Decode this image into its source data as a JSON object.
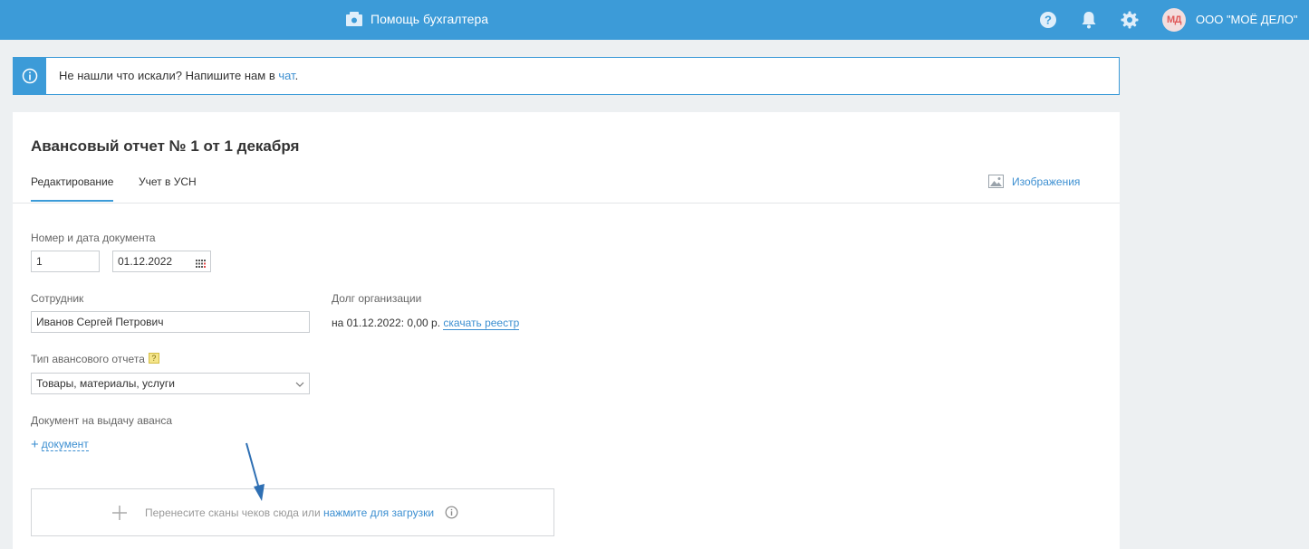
{
  "topbar": {
    "help_label": "Помощь бухгалтера",
    "org_initials": "МД",
    "org_name": "ООО \"МОЁ ДЕЛО\"",
    "bg_color": "#3c9bd8"
  },
  "banner": {
    "text": "Не нашли что искали? Напишите нам в ",
    "link": "чат",
    "suffix": "."
  },
  "document": {
    "title": "Авансовый отчет № 1 от 1 декабря",
    "tabs": [
      {
        "label": "Редактирование",
        "active": true
      },
      {
        "label": "Учет в УСН",
        "active": false
      }
    ],
    "images_label": "Изображения"
  },
  "form": {
    "number_date_label": "Номер и дата документа",
    "number_value": "1",
    "date_value": "01.12.2022",
    "employee_label": "Сотрудник",
    "employee_value": "Иванов Сергей Петрович",
    "debt_label": "Долг организации",
    "debt_text": "на 01.12.2022: 0,00 р. ",
    "debt_link": "скачать реестр",
    "report_type_label": "Тип авансового отчета",
    "report_type_help": "?",
    "report_type_value": "Товары, материалы, услуги",
    "advance_doc_label": "Документ на выдачу аванса",
    "add_doc_plus": "+",
    "add_doc_label": "документ"
  },
  "dropzone": {
    "text": "Перенесите сканы чеков сюда или ",
    "link": "нажмите для загрузки"
  }
}
